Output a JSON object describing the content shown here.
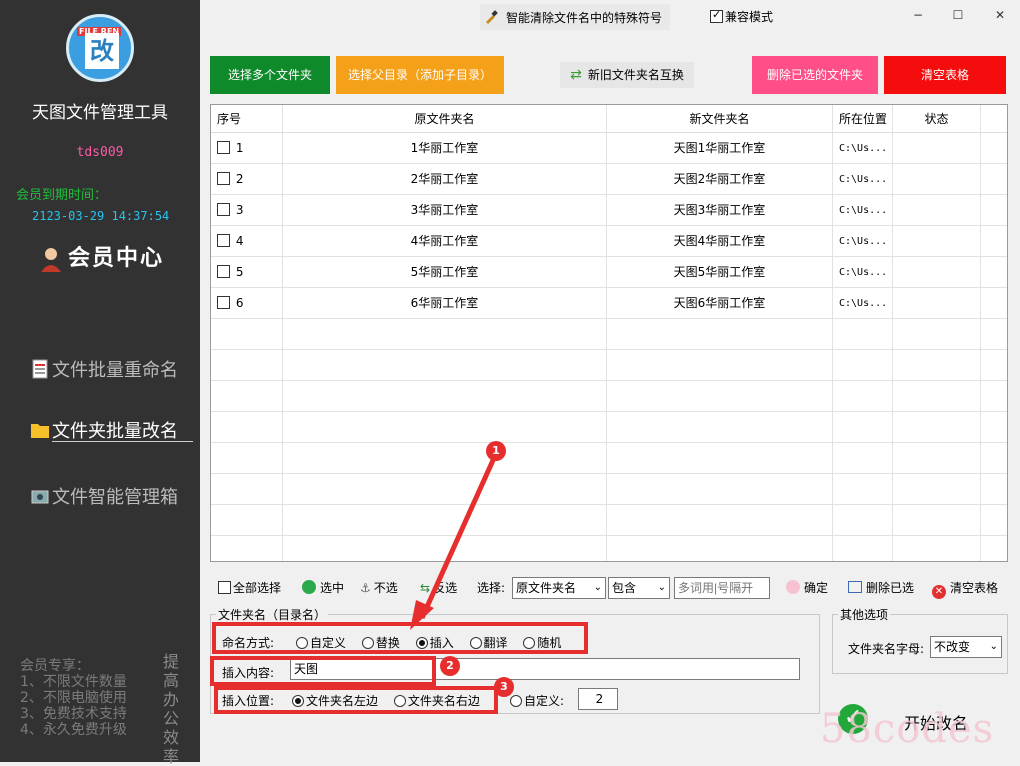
{
  "sidebar": {
    "logo_tag": "FILE REN",
    "logo_glyph": "改",
    "app_title": "天图文件管理工具",
    "username": "tds009",
    "expiry_label": "会员到期时间：",
    "expiry_date": "2123-03-29 14:37:54",
    "member_center": "会员中心",
    "nav": {
      "file_batch_rename": "文件批量重命名",
      "folder_batch_rename": "文件夹批量改名",
      "smart_manager": "文件智能管理箱"
    },
    "perks": [
      "会员专享：",
      "1、不限文件数量",
      "2、不限电脑使用",
      "3、免费技术支持",
      "4、永久免费升级"
    ],
    "slogan": "提高办公效率"
  },
  "titlebar": {
    "title": "智能清除文件名中的特殊符号",
    "compat_mode": "兼容模式",
    "minimize": "−",
    "maximize": "☐",
    "close": "✕"
  },
  "buttons": {
    "select_multi": "选择多个文件夹",
    "select_parent": "选择父目录（添加子目录）",
    "swap_names": "新旧文件夹名互换",
    "delete_selected": "删除已选的文件夹",
    "clear_table": "清空表格"
  },
  "colors": {
    "select_multi": "#0f8a2a",
    "select_parent": "#f5a019",
    "delete_selected": "#ff4f86",
    "clear_table": "#f50d0d",
    "annotation": "#e62e2e"
  },
  "table": {
    "headers": [
      "序号",
      "原文件夹名",
      "新文件夹名",
      "所在位置",
      "状态"
    ],
    "rows": [
      {
        "index": "1",
        "old": "1华丽工作室",
        "new": "天图1华丽工作室",
        "location": "C:\\Us...",
        "status": ""
      },
      {
        "index": "2",
        "old": "2华丽工作室",
        "new": "天图2华丽工作室",
        "location": "C:\\Us...",
        "status": ""
      },
      {
        "index": "3",
        "old": "3华丽工作室",
        "new": "天图3华丽工作室",
        "location": "C:\\Us...",
        "status": ""
      },
      {
        "index": "4",
        "old": "4华丽工作室",
        "new": "天图4华丽工作室",
        "location": "C:\\Us...",
        "status": ""
      },
      {
        "index": "5",
        "old": "5华丽工作室",
        "new": "天图5华丽工作室",
        "location": "C:\\Us...",
        "status": ""
      },
      {
        "index": "6",
        "old": "6华丽工作室",
        "new": "天图6华丽工作室",
        "location": "C:\\Us...",
        "status": ""
      }
    ]
  },
  "selection_toolbar": {
    "select_all": "全部选择",
    "select": "选中",
    "unselect": "不选",
    "invert": "反选",
    "select_label": "选择:",
    "field_value": "原文件夹名",
    "match_value": "包含",
    "keyword_placeholder": "多词用|号隔开",
    "confirm": "确定",
    "delete_selected": "删除已选",
    "clear_table": "清空表格"
  },
  "naming": {
    "group_title": "文件夹名（目录名）",
    "method_label": "命名方式:",
    "methods": [
      "自定义",
      "替换",
      "插入",
      "翻译",
      "随机"
    ],
    "method_selected": "插入",
    "insert_label": "插入内容:",
    "insert_value": "天图",
    "position_label": "插入位置:",
    "positions": [
      "文件夹名左边",
      "文件夹名右边"
    ],
    "position_selected": "文件夹名左边",
    "custom_label": "自定义:",
    "custom_value": "2"
  },
  "other_options": {
    "title": "其他选项",
    "case_label": "文件夹名字母:",
    "case_value": "不改变"
  },
  "start_button": "开始改名",
  "annotations": [
    "1",
    "2",
    "3"
  ],
  "watermark": "58codes"
}
